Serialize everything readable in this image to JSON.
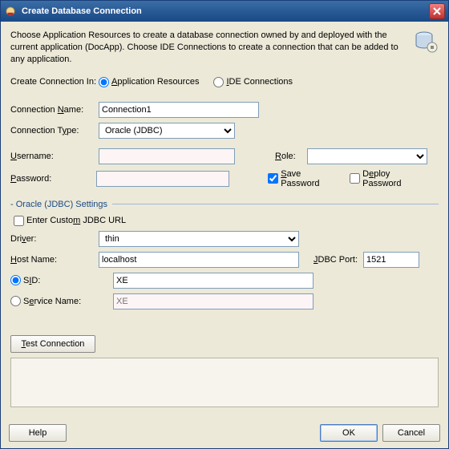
{
  "title": "Create Database Connection",
  "description": "Choose Application Resources to create a database connection owned by and deployed with the current application (DocApp). Choose IDE Connections to create a connection that can be added to any application.",
  "createIn": {
    "label": "Create Connection In:",
    "opt1": "Application Resources",
    "opt2": "IDE Connections"
  },
  "connName": {
    "label": "Connection Name:",
    "value": "Connection1"
  },
  "connType": {
    "label": "Connection Type:",
    "value": "Oracle (JDBC)"
  },
  "username": {
    "label": "Username:",
    "value": ""
  },
  "password": {
    "label": "Password:",
    "value": ""
  },
  "role": {
    "label": "Role:",
    "value": ""
  },
  "savePw": "Save Password",
  "deployPw": "Deploy Password",
  "groupTitle": "Oracle (JDBC) Settings",
  "customUrl": "Enter Custom JDBC URL",
  "driver": {
    "label": "Driver:",
    "value": "thin"
  },
  "host": {
    "label": "Host Name:",
    "value": "localhost"
  },
  "port": {
    "label": "JDBC Port:",
    "value": "1521"
  },
  "sid": {
    "label": "SID:",
    "value": "XE"
  },
  "service": {
    "label": "Service Name:",
    "placeholder": "XE"
  },
  "testBtn": "Test Connection",
  "helpBtn": "Help",
  "okBtn": "OK",
  "cancelBtn": "Cancel"
}
